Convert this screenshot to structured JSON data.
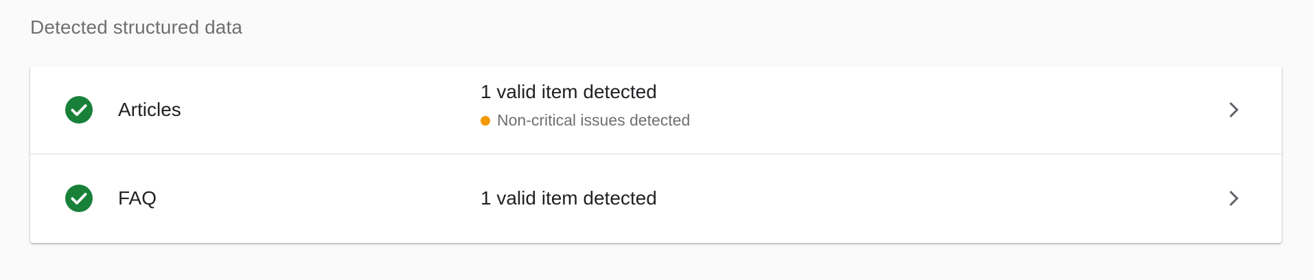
{
  "section": {
    "title": "Detected structured data"
  },
  "colors": {
    "valid_green": "#188038",
    "warning_orange": "#f29900",
    "chevron_gray": "#5f6368"
  },
  "items": [
    {
      "label": "Articles",
      "status": "1 valid item detected",
      "sub_status": "Non-critical issues detected",
      "status_icon": "check-circle-icon",
      "nav_icon": "chevron-right-icon"
    },
    {
      "label": "FAQ",
      "status": "1 valid item detected",
      "status_icon": "check-circle-icon",
      "nav_icon": "chevron-right-icon"
    }
  ]
}
